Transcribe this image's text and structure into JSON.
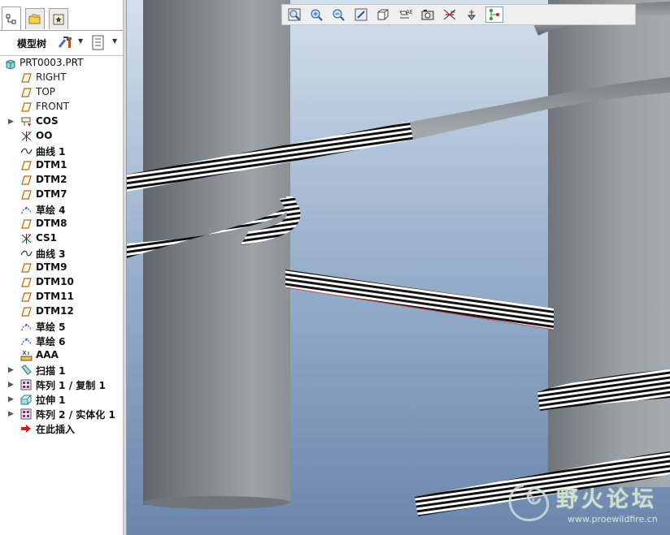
{
  "panel": {
    "tabs": [
      {
        "name": "model-tree-tab-icon"
      },
      {
        "name": "folder-browser-tab-icon"
      },
      {
        "name": "favorites-tab-icon"
      }
    ],
    "tree_label": "模型树",
    "tools_icon": "tools-icon",
    "settings_icon": "list-settings-icon"
  },
  "tree": {
    "root": "PRT0003.PRT",
    "items": [
      {
        "label": "RIGHT",
        "icon": "datum-plane-icon",
        "expandable": false,
        "bold": false
      },
      {
        "label": "TOP",
        "icon": "datum-plane-icon",
        "expandable": false,
        "bold": false
      },
      {
        "label": "FRONT",
        "icon": "datum-plane-icon",
        "expandable": false,
        "bold": false
      },
      {
        "label": "COS",
        "icon": "cosmetic-icon",
        "expandable": true,
        "bold": true
      },
      {
        "label": "OO",
        "icon": "coordinate-system-icon",
        "expandable": false,
        "bold": true
      },
      {
        "label": "曲线 1",
        "icon": "curve-icon",
        "expandable": false,
        "bold": true
      },
      {
        "label": "DTM1",
        "icon": "datum-plane-icon",
        "expandable": false,
        "bold": true
      },
      {
        "label": "DTM2",
        "icon": "datum-plane-icon",
        "expandable": false,
        "bold": true
      },
      {
        "label": "DTM7",
        "icon": "datum-plane-icon",
        "expandable": false,
        "bold": true
      },
      {
        "label": "草绘 4",
        "icon": "sketch-icon",
        "expandable": false,
        "bold": true
      },
      {
        "label": "DTM8",
        "icon": "datum-plane-icon",
        "expandable": false,
        "bold": true
      },
      {
        "label": "CS1",
        "icon": "coordinate-system-icon",
        "expandable": false,
        "bold": true
      },
      {
        "label": "曲线 3",
        "icon": "curve-icon",
        "expandable": false,
        "bold": true
      },
      {
        "label": "DTM9",
        "icon": "datum-plane-icon",
        "expandable": false,
        "bold": true
      },
      {
        "label": "DTM10",
        "icon": "datum-plane-icon",
        "expandable": false,
        "bold": true
      },
      {
        "label": "DTM11",
        "icon": "datum-plane-icon",
        "expandable": false,
        "bold": true
      },
      {
        "label": "DTM12",
        "icon": "datum-plane-icon",
        "expandable": false,
        "bold": true
      },
      {
        "label": "草绘 5",
        "icon": "sketch-icon",
        "expandable": false,
        "bold": true
      },
      {
        "label": "草绘 6",
        "icon": "sketch-icon",
        "expandable": false,
        "bold": true
      },
      {
        "label": "AAA",
        "icon": "analysis-icon",
        "expandable": false,
        "bold": true
      },
      {
        "label": "扫描 1",
        "icon": "sweep-icon",
        "expandable": true,
        "bold": true
      },
      {
        "label": "阵列 1 / 复制 1",
        "icon": "pattern-icon",
        "expandable": true,
        "bold": true
      },
      {
        "label": "拉伸 1",
        "icon": "extrude-icon",
        "expandable": true,
        "bold": true
      },
      {
        "label": "阵列 2 / 实体化 1",
        "icon": "pattern-icon",
        "expandable": true,
        "bold": true
      },
      {
        "label": "在此插入",
        "icon": "insert-here-arrow-icon",
        "expandable": false,
        "bold": true
      }
    ]
  },
  "view_toolbar": {
    "buttons": [
      {
        "name": "zoom-window-icon"
      },
      {
        "name": "zoom-in-icon"
      },
      {
        "name": "zoom-out-icon"
      },
      {
        "name": "refit-icon"
      },
      {
        "name": "saved-views-icon"
      },
      {
        "name": "display-style-icon"
      },
      {
        "name": "view-manager-icon"
      },
      {
        "name": "datum-display-icon"
      },
      {
        "name": "annotation-display-icon"
      },
      {
        "name": "spin-center-icon"
      }
    ]
  },
  "watermark": {
    "title": "野火论坛",
    "url": "www.proewildfire.cn"
  },
  "colors": {
    "viewport_top": "#c9d6e7",
    "viewport_bottom": "#6d87ac",
    "cylinder_dark": "#5c6268",
    "cylinder_light": "#a4a9ae",
    "tree_text": "#222222"
  }
}
